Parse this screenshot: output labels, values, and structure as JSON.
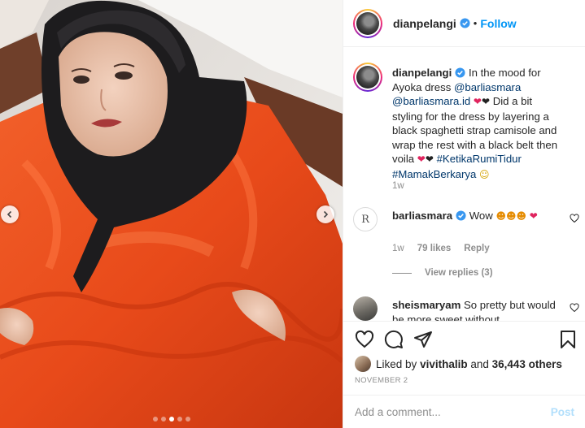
{
  "post": {
    "username": "dianpelangi",
    "follow_label": "Follow",
    "separator": "•",
    "media": {
      "slide_count": 5,
      "active_slide": 3
    }
  },
  "caption": {
    "username": "dianpelangi",
    "text_1": "In the mood for Ayoka dress",
    "mention_1": "@barliasmara",
    "mention_2": "@barliasmara.id",
    "emoji_1": "❤",
    "emoji_2": "❤",
    "text_2": "Did a bit styling for the dress by layering a black spaghetti strap camisole and wrap the rest with a black belt then voila",
    "emoji_3": "❤",
    "emoji_4": "❤",
    "hashtag_1": "#KetikaRumiTidur",
    "hashtag_2": "#MamakBerkarya",
    "emoji_5": "☺",
    "time": "1w"
  },
  "comments": [
    {
      "username": "barliasmara",
      "text": "Wow",
      "emoji_1": "☻",
      "emoji_2": "☻",
      "emoji_3": "☻",
      "emoji_4": "❤",
      "time": "1w",
      "likes": "79 likes",
      "reply_label": "Reply",
      "view_replies": "View replies (3)",
      "avatar_letter": "R"
    },
    {
      "username": "sheismaryam",
      "text": "So pretty but would be more sweet without"
    }
  ],
  "actions": {
    "liked_by_prefix": "Liked by",
    "liked_by_user": "vivithalib",
    "liked_by_and": "and",
    "liked_by_others": "36,443 others",
    "date": "NOVEMBER 2"
  },
  "comment_box": {
    "placeholder": "Add a comment...",
    "post_label": "Post"
  },
  "colors": {
    "link": "#00376b",
    "follow": "#0095f6",
    "dress": "#e84a1a",
    "verified": "#3897f0"
  }
}
